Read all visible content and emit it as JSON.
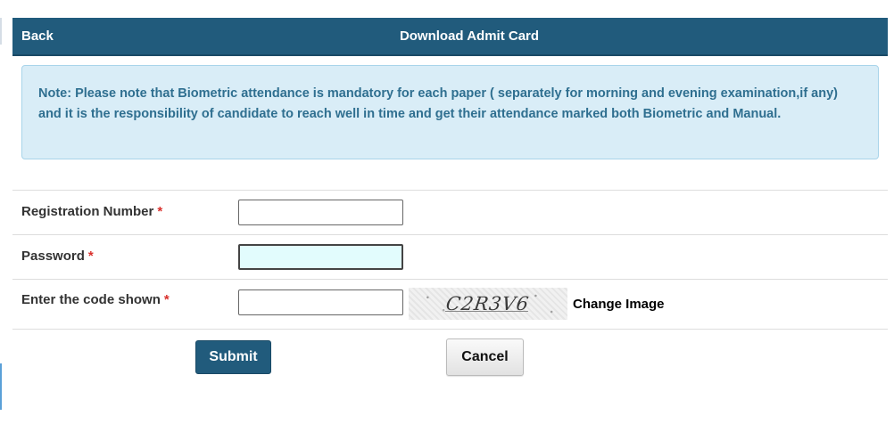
{
  "header": {
    "back_label": "Back",
    "title": "Download Admit Card"
  },
  "note": {
    "text": "Note: Please note that Biometric attendance is mandatory for each paper ( separately for morning and evening examination,if any) and it is the responsibility of candidate to reach well in time and get their attendance marked both Biometric and Manual."
  },
  "form": {
    "registration_label": "Registration Number",
    "registration_value": "",
    "password_label": "Password",
    "password_value": "",
    "code_label": "Enter the code shown",
    "code_value": "",
    "required_marker": "*",
    "captcha_text": "C2R3V6",
    "change_image_label": "Change Image"
  },
  "actions": {
    "submit_label": "Submit",
    "cancel_label": "Cancel"
  },
  "colors": {
    "header_bg": "#215b7c",
    "note_bg": "#d9edf7",
    "note_text": "#2f6f90",
    "required": "#d9302c",
    "focused_input_bg": "#e2fcfd"
  }
}
